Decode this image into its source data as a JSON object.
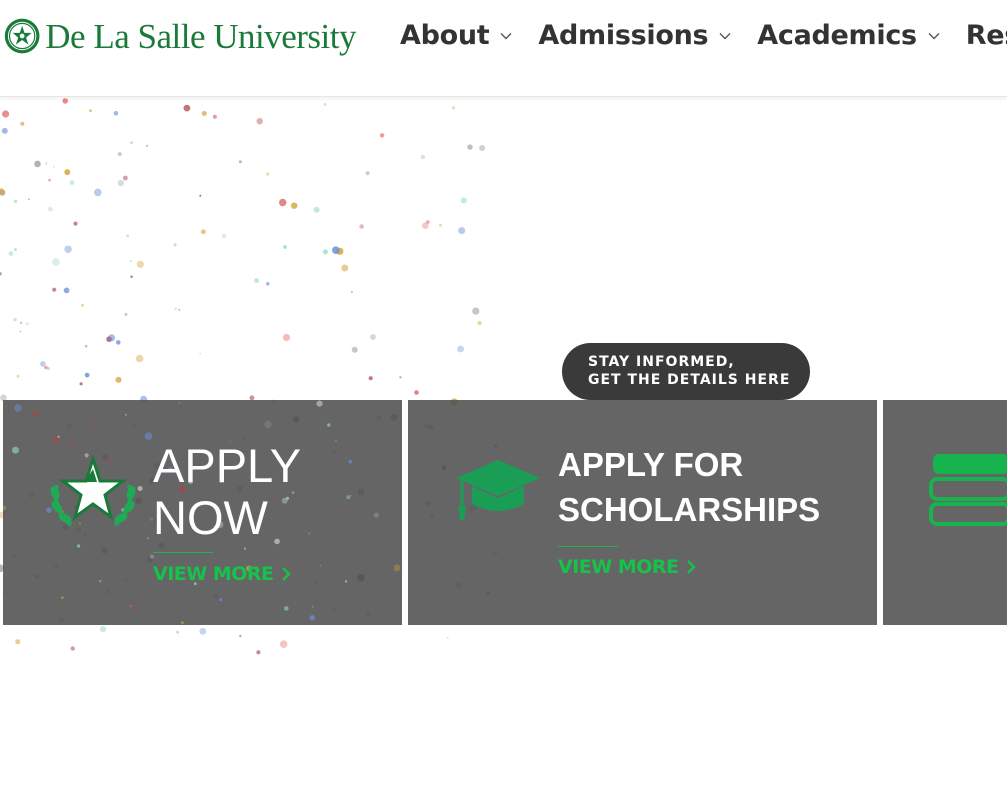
{
  "header": {
    "logo_text": "De La Salle University",
    "nav": [
      {
        "label": "About"
      },
      {
        "label": "Admissions"
      },
      {
        "label": "Academics"
      },
      {
        "label": "Resea"
      }
    ]
  },
  "hero": {
    "cta_line1": "STAY INFORMED,",
    "cta_line2": "GET THE DETAILS HERE"
  },
  "cards": [
    {
      "title_line1": "APPLY",
      "title_line2": "NOW",
      "more": "VIEW MORE",
      "icon": "star-laurel-icon"
    },
    {
      "title_line1": "APPLY FOR",
      "title_line2": "SCHOLARSHIPS",
      "more": "VIEW MORE",
      "icon": "graduation-cap-icon"
    },
    {
      "icon": "books-icon"
    }
  ],
  "colors": {
    "brand_green": "#1a7a3a",
    "accent_green": "#16c34a",
    "card_bg": "#5a5a5a",
    "pill_bg": "#3a3a3a"
  }
}
